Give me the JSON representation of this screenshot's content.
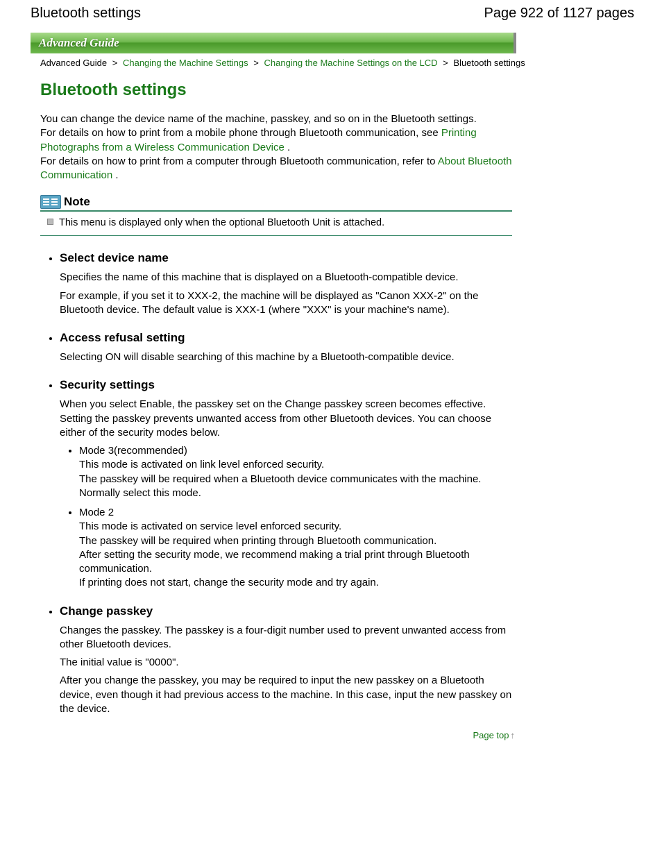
{
  "header": {
    "left": "Bluetooth settings",
    "right": "Page 922 of 1127 pages"
  },
  "banner": "Advanced Guide",
  "breadcrumb": {
    "root": "Advanced Guide",
    "link1": "Changing the Machine Settings",
    "link2": "Changing the Machine Settings on the LCD",
    "current": "Bluetooth settings",
    "sep": ">"
  },
  "title": "Bluetooth settings",
  "intro": {
    "l1": "You can change the device name of the machine, passkey, and so on in the Bluetooth settings.",
    "l2a": "For details on how to print from a mobile phone through Bluetooth communication, see ",
    "l2link": "Printing Photographs from a Wireless Communication Device",
    "l2b": ".",
    "l3a": "For details on how to print from a computer through Bluetooth communication, refer to ",
    "l3link": "About Bluetooth Communication",
    "l3b": "."
  },
  "note": {
    "title": "Note",
    "text": "This menu is displayed only when the optional Bluetooth Unit is attached."
  },
  "items": [
    {
      "title": "Select device name",
      "paras": [
        "Specifies the name of this machine that is displayed on a Bluetooth-compatible device.",
        "For example, if you set it to XXX-2, the machine will be displayed as \"Canon XXX-2\" on the Bluetooth device. The default value is XXX-1 (where \"XXX\" is your machine's name)."
      ]
    },
    {
      "title": "Access refusal setting",
      "paras": [
        "Selecting ON will disable searching of this machine by a Bluetooth-compatible device."
      ]
    },
    {
      "title": "Security settings",
      "paras": [
        "When you select Enable, the passkey set on the Change passkey screen becomes effective. Setting the passkey prevents unwanted access from other Bluetooth devices. You can choose either of the security modes below."
      ],
      "sub": [
        {
          "head": "Mode 3(recommended)",
          "lines": [
            "This mode is activated on link level enforced security.",
            "The passkey will be required when a Bluetooth device communicates with the machine.",
            "Normally select this mode."
          ]
        },
        {
          "head": "Mode 2",
          "lines": [
            "This mode is activated on service level enforced security.",
            "The passkey will be required when printing through Bluetooth communication.",
            "After setting the security mode, we recommend making a trial print through Bluetooth communication.",
            "If printing does not start, change the security mode and try again."
          ]
        }
      ]
    },
    {
      "title": "Change passkey",
      "paras": [
        "Changes the passkey. The passkey is a four-digit number used to prevent unwanted access from other Bluetooth devices.",
        "The initial value is \"0000\".",
        "After you change the passkey, you may be required to input the new passkey on a Bluetooth device, even though it had previous access to the machine. In this case, input the new passkey on the device."
      ]
    }
  ],
  "pagetop": "Page top"
}
